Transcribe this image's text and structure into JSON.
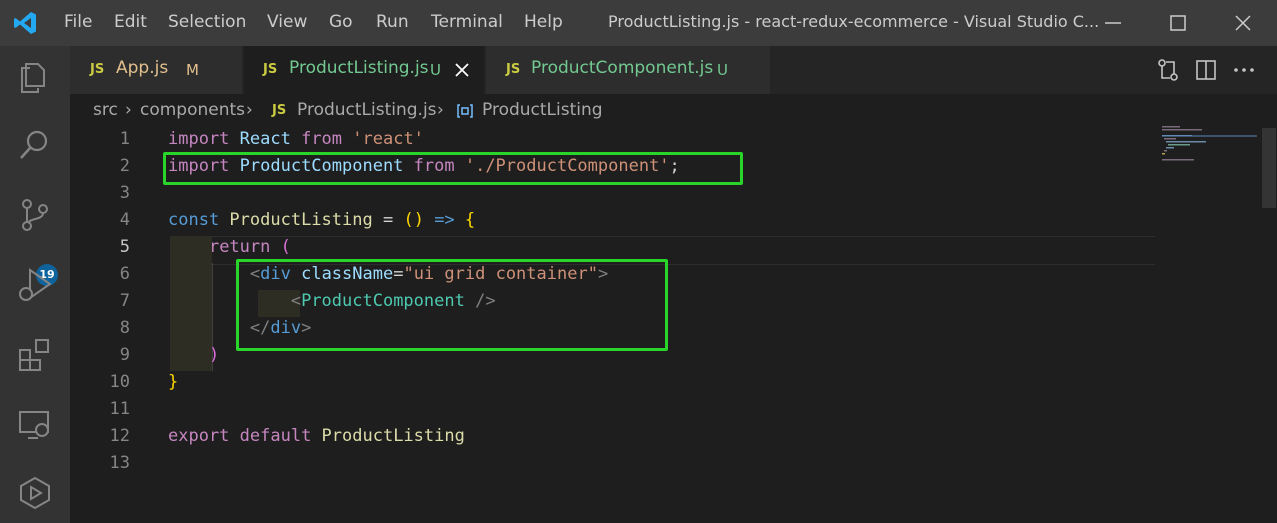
{
  "titlebar": {
    "menu": [
      "File",
      "Edit",
      "Selection",
      "View",
      "Go",
      "Run",
      "Terminal",
      "Help"
    ],
    "window_title": "ProductListing.js - react-redux-ecommerce - Visual Studio C..."
  },
  "activitybar": {
    "icons": [
      "files-icon",
      "search-icon",
      "source-control-icon",
      "run-debug-icon",
      "extensions-icon",
      "remote-explorer-icon",
      "deploy-icon"
    ],
    "source_control_badge": "19"
  },
  "tabs": [
    {
      "icon_text": "JS",
      "label": "App.js",
      "status": "M",
      "status_color": "#e2c08d",
      "active": false
    },
    {
      "icon_text": "JS",
      "label": "ProductListing.js",
      "status": "U",
      "status_color": "#73c991",
      "active": true
    },
    {
      "icon_text": "JS",
      "label": "ProductComponent.js",
      "status": "U",
      "status_color": "#73c991",
      "active": false
    }
  ],
  "breadcrumbs": {
    "part1": "src",
    "part2": "components",
    "js_badge": "JS",
    "part3": "ProductListing.js",
    "part4": "ProductListing"
  },
  "editor": {
    "line_numbers": [
      "1",
      "2",
      "3",
      "4",
      "5",
      "6",
      "7",
      "8",
      "9",
      "10",
      "11",
      "12",
      "13"
    ],
    "current_line": "5",
    "lines": [
      [
        [
          "kw",
          "import "
        ],
        [
          "id",
          "React "
        ],
        [
          "kw",
          "from "
        ],
        [
          "str",
          "'react'"
        ]
      ],
      [
        [
          "kw",
          "import "
        ],
        [
          "id",
          "ProductComponent "
        ],
        [
          "kw",
          "from "
        ],
        [
          "str",
          "'./ProductComponent'"
        ],
        [
          "plain",
          ";"
        ]
      ],
      [],
      [
        [
          "kw2",
          "const "
        ],
        [
          "fn",
          "ProductListing "
        ],
        [
          "plain",
          "= "
        ],
        [
          "brace",
          "("
        ],
        [
          "brace",
          ")"
        ],
        [
          "plain",
          " "
        ],
        [
          "kw2",
          "=>"
        ],
        [
          "plain",
          " "
        ],
        [
          "brace",
          "{"
        ]
      ],
      [
        [
          "plain",
          "    "
        ],
        [
          "kw",
          "return "
        ],
        [
          "paren",
          "("
        ]
      ],
      [
        [
          "plain",
          "        "
        ],
        [
          "punc",
          "<"
        ],
        [
          "kw2",
          "div "
        ],
        [
          "attr",
          "className"
        ],
        [
          "plain",
          "="
        ],
        [
          "str",
          "\"ui grid container\""
        ],
        [
          "punc",
          ">"
        ]
      ],
      [
        [
          "plain",
          "            "
        ],
        [
          "punc",
          "<"
        ],
        [
          "tag",
          "ProductComponent "
        ],
        [
          "punc",
          "/>"
        ]
      ],
      [
        [
          "plain",
          "        "
        ],
        [
          "punc",
          "</"
        ],
        [
          "kw2",
          "div"
        ],
        [
          "punc",
          ">"
        ]
      ],
      [
        [
          "plain",
          "    "
        ],
        [
          "paren",
          ")"
        ]
      ],
      [
        [
          "brace",
          "}"
        ]
      ],
      [],
      [
        [
          "kw",
          "export "
        ],
        [
          "kw",
          "default "
        ],
        [
          "fn",
          "ProductListing"
        ]
      ],
      []
    ]
  },
  "colors": {
    "highlight_box": "#2ad52a",
    "accent": "#0e639c"
  }
}
